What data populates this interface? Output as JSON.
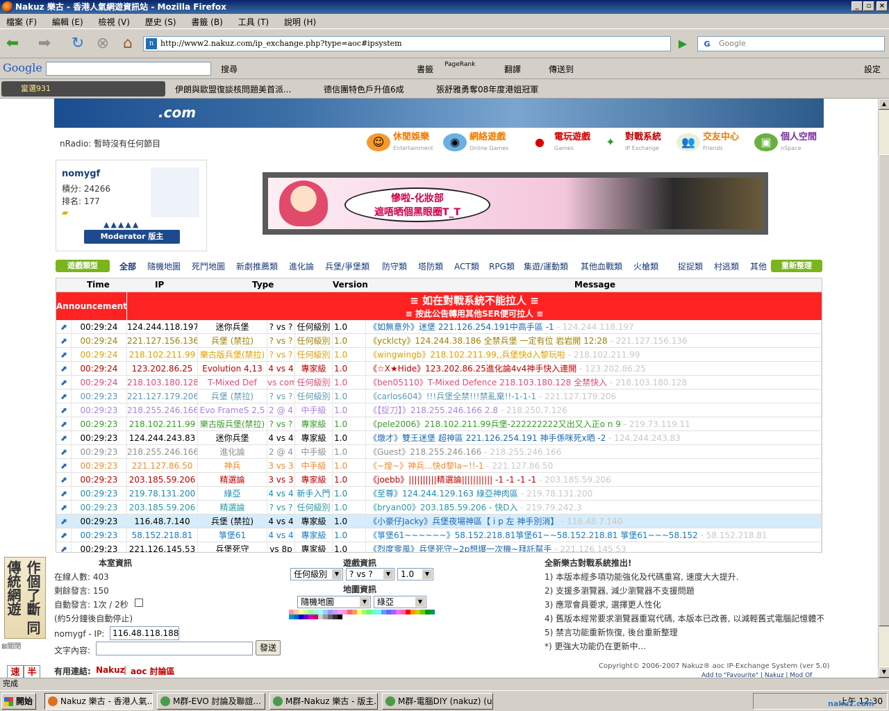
{
  "window": {
    "title": "Nakuz 樂古 - 香港人氣網遊資訊站 - Mozilla Firefox"
  },
  "menu": [
    "檔案 (F)",
    "編輯 (E)",
    "檢視 (V)",
    "歷史 (S)",
    "書籤 (B)",
    "工具 (T)",
    "說明 (H)"
  ],
  "address": {
    "url": "http://www2.nakuz.com/ip_exchange.php?type=aoc#ipsystem",
    "search_placeholder": "Google"
  },
  "google_toolbar": {
    "logo": "Google",
    "items": [
      "搜尋",
      "書籤",
      "PageRank",
      "翻譯",
      "傳送到",
      "設定"
    ]
  },
  "bookmarks": {
    "radio": "當選931",
    "items": [
      "伊朗與歐盟復談核問題美首派...",
      "德信團特色戶升值6成",
      "張舒雅勇奪08年度港姐冠軍"
    ]
  },
  "site": {
    "logo": ".com",
    "nradio": "nRadio: 暫時沒有任何節目",
    "nav": [
      {
        "label": "休閒娛樂",
        "sub": "Entertainment",
        "color": "#f07a00"
      },
      {
        "label": "網絡遊戲",
        "sub": "Online Games",
        "color": "#f07a00"
      },
      {
        "label": "電玩遊戲",
        "sub": "Games",
        "color": "#d00000"
      },
      {
        "label": "對戰系統",
        "sub": "IP Exchange",
        "color": "#c00000"
      },
      {
        "label": "交友中心",
        "sub": "Friends",
        "color": "#f07a00"
      },
      {
        "label": "個人空間",
        "sub": "nSpace",
        "color": "#7a2aa0"
      }
    ],
    "user": {
      "name": "nomygf",
      "points": "積分: 24266",
      "rank": "排名: 177",
      "moderator": "Moderator 版主"
    },
    "ad": {
      "line1": "慘啦-化妝部",
      "line2": "遮唔晒個黑眼圈T_T"
    },
    "category_tag": "遊戲類型",
    "categories": [
      "全部",
      "隨機地圖",
      "死鬥地圖",
      "新劇推薦類",
      "進化論",
      "兵堡/爭堡類",
      "防守類",
      "塔防類",
      "ACT類",
      "RPG類",
      "集遊/運動類",
      "其他血戰類",
      "火槍類",
      "捉捉類",
      "村逃類",
      "其他"
    ],
    "reset": "重新整理"
  },
  "table": {
    "headers": [
      "Time",
      "IP",
      "Type",
      "Version",
      "Message"
    ],
    "announcement": {
      "label": "Announcement",
      "line1": "≡ 如在對戰系統不能拉人 ≡",
      "line2": "≡ 按此公告轉用其他SER便可拉人 ≡"
    },
    "rows": [
      {
        "time": "00:29:24",
        "ip": "124.244.118.197",
        "type": "迷你兵堡",
        "vs": "? vs ?",
        "level": "任何級別",
        "ver": "1.0",
        "msg": "《如無意外》迷堡 221.126.254.191中高手區 -1",
        "src": "- 124.244.118.197",
        "color": "#000000",
        "nick": "#1a6ab5"
      },
      {
        "time": "00:29:24",
        "ip": "221.127.156.136",
        "type": "兵堡 (禁拉)",
        "vs": "? vs ?",
        "level": "任何級別",
        "ver": "1.0",
        "msg": "《ycklcty》124.244.38.186 全禁兵堡 一定有位 岩岩開 12:28",
        "src": "- 221.127.156.136",
        "color": "#a08000",
        "nick": "#a08000"
      },
      {
        "time": "00:29:24",
        "ip": "218.102.211.99",
        "type": "樂古版兵堡(禁拉)",
        "vs": "? vs ?",
        "level": "任何級別",
        "ver": "1.0",
        "msg": "《wingwingb》218.102.211.99,,兵堡快d入黎玩啦",
        "src": "- 218.102.211.99",
        "color": "#e0a000",
        "nick": "#e0a000"
      },
      {
        "time": "00:29:24",
        "ip": "123.202.86.25",
        "type": "Evolution 4,13",
        "vs": "4 vs 4",
        "level": "專家級",
        "ver": "1.0",
        "msg": "《☆X★Hide》123.202.86.25進化論4v4神手快入連開",
        "src": "- 123.202.86.25",
        "color": "#c00000",
        "nick": "#c00000"
      },
      {
        "time": "00:29:24",
        "ip": "218.103.180.128",
        "type": "T-Mixed Def",
        "vs": "vs com",
        "level": "任何級別",
        "ver": "1.0",
        "msg": "《ben05110》T-Mixed Defence 218.103.180.128 全禁快入",
        "src": "- 218.103.180.128",
        "color": "#e04a7a",
        "nick": "#e04a7a"
      },
      {
        "time": "00:29:23",
        "ip": "221.127.179.206",
        "type": "兵堡 (禁拉)",
        "vs": "? vs ?",
        "level": "任何級別",
        "ver": "1.0",
        "msg": "《carlos604》!!!兵堡全禁!!!禁亂棄!!-1-1-1",
        "src": "- 221.127.179.206",
        "color": "#5a9ab5",
        "nick": "#5a9ab5"
      },
      {
        "time": "00:29:23",
        "ip": "218.255.246.166",
        "type": "Evo FrameS 2,5",
        "vs": "2 @ 4",
        "level": "中手級",
        "ver": "1.0",
        "msg": "《【捉刀】》218.255.246.166 2.8",
        "src": "- 218.250.7.126",
        "color": "#b080e0",
        "nick": "#b080e0"
      },
      {
        "time": "00:29:23",
        "ip": "218.102.211.99",
        "type": "樂古版兵堡(禁拉)",
        "vs": "? vs ?",
        "level": "專家級",
        "ver": "1.0",
        "msg": "《pele2006》218.102.211.99兵堡-222222222又出又入正o n 9",
        "src": "- 219.73.119.11",
        "color": "#3a9a2a",
        "nick": "#3a9a2a"
      },
      {
        "time": "00:29:23",
        "ip": "124.244.243.83",
        "type": "迷你兵堡",
        "vs": "4 vs 4",
        "level": "專家級",
        "ver": "1.0",
        "msg": "《燉才》雙王迷堡 超神區 221.126.254.191 神手係咪死x晒 -2",
        "src": "- 124.244.243.83",
        "color": "#000000",
        "nick": "#1a6ab5"
      },
      {
        "time": "00:29:23",
        "ip": "218.255.246.166",
        "type": "進化論",
        "vs": "2 @ 4",
        "level": "中手級",
        "ver": "1.0",
        "msg": "《Guest》218.255.246.166",
        "src": "- 218.255.246.166",
        "color": "#909090",
        "nick": "#909090"
      },
      {
        "time": "00:29:23",
        "ip": "221.127.86.50",
        "type": "神兵",
        "vs": "3 vs 3",
        "level": "中手級",
        "ver": "1.0",
        "msg": "《~煌~》神兵...快d黎la~!!-1",
        "src": "- 221.127.86.50",
        "color": "#f08a30",
        "nick": "#f08a30"
      },
      {
        "time": "00:29:23",
        "ip": "203.185.59.206",
        "type": "精選論",
        "vs": "3 vs 3",
        "level": "專家級",
        "ver": "1.0",
        "msg": "《joebb》||||||||||精選論||||||||||| -1 -1 -1 -1",
        "src": "- 203.185.59.206",
        "color": "#c00000",
        "nick": "#c00000"
      },
      {
        "time": "00:29:23",
        "ip": "219.78.131.200",
        "type": "綠亞",
        "vs": "4 vs 4",
        "level": "新手入門",
        "ver": "1.0",
        "msg": "《至尊》124.244.129.163 綠亞神肉區",
        "src": "- 219.78.131.200",
        "color": "#1a8ab5",
        "nick": "#1a8ab5"
      },
      {
        "time": "00:29:23",
        "ip": "203.185.59.206",
        "type": "精選論",
        "vs": "? vs ?",
        "level": "任何級別",
        "ver": "1.0",
        "msg": "《bryan00》203.185.59.206 - 快D入",
        "src": "- 219.79.242.3",
        "color": "#2a9aa0",
        "nick": "#2a9aa0"
      },
      {
        "time": "00:29:23",
        "ip": "116.48.7.140",
        "type": "兵堡 (禁拉)",
        "vs": "4 vs 4",
        "level": "專家級",
        "ver": "1.0",
        "msg": "《小豪仔Jacky》兵堡夜場神區【 i p 左 神手別消】",
        "src": "- 116.48.7.140",
        "color": "#000000",
        "nick": "#1a6ab5",
        "hl": true
      },
      {
        "time": "00:29:23",
        "ip": "58.152.218.81",
        "type": "箏堡61",
        "vs": "4 vs 4",
        "level": "專家級",
        "ver": "1.0",
        "msg": "《箏堡61~~~~~~》58.152.218.81箏堡61~~58.152.218.81 箏堡61~~~58.152",
        "src": "- 58.152.218.81",
        "color": "#1a7ac5",
        "nick": "#1a7ac5"
      },
      {
        "time": "00:29:23",
        "ip": "221.126.145.53",
        "type": "兵堡死守",
        "vs": "vs 8p",
        "level": "專家級",
        "ver": "1.0",
        "msg": "《烈度零風》兵堡死守~2p想爆一次機~拜託幫手",
        "src": "- 221.126.145.53",
        "color": "#000000",
        "nick": "#1a6ab5"
      }
    ]
  },
  "bottom": {
    "room_title": "本室資訊",
    "online": "在線人數: 403",
    "remaining": "剩餘發言: 150",
    "auto": "自動發言: 1次 / 2秒",
    "auto_note": "(約5分鐘後自動停止)",
    "ip_label": "nomygf - IP:",
    "ip_value": "116.48.118.188",
    "content_label": "文字內容:",
    "send": "發送",
    "links_label": "有用連結:",
    "link1": "Nakuz",
    "link2": "aoc 討論區",
    "game_title": "遊戲資訊",
    "level_sel": "任何級別",
    "vs_sel": "? vs ?",
    "ver_sel": "1.0",
    "map_title": "地圖資訊",
    "map_sel": "隨機地圖",
    "map2_sel": "綠亞",
    "news_title": "全新樂古對戰系統推出!",
    "news": [
      "1) 本版本經多項功能強化及代碼重寫, 速度大大提升.",
      "2) 支援多瀏覽器, 減少瀏覽器不支援問題",
      "3) 應眾會員要求, 選擇更人性化",
      "4) 舊版本經常要求瀏覽器重寫代碼, 本版本已改善, 以減輕舊式電腦記憶體不",
      "5) 禁言功能重新恢復, 後台重新整理",
      "*) 更強大功能仍在更新中..."
    ],
    "copyright": "Copyright© 2006-2007  Nakuz® aoc IP-Exchange System (ver 5.0)",
    "footer_links": "Add to \"Favourite\" | Nakuz | Mod Of"
  },
  "side": {
    "flash_text": "作個了斷 同傳統網遊",
    "close": "關閉",
    "k1": "速",
    "k2": "半"
  },
  "status": {
    "text": "完成"
  },
  "taskbar": {
    "start": "開始",
    "tasks": [
      "Nakuz 樂古 - 香港人氣...",
      "M群-EVO 討論及聯誼...",
      "M群-Nakuz 樂古 - 版主...",
      "M群-電腦DIY (nakuz) (u..."
    ],
    "clock": "上午 12:30",
    "watermark": "nakuz.com"
  },
  "colors": {
    "announcement": "#ff2222",
    "accent": "#1a3c7a",
    "category_tag": "#7ab51d"
  }
}
